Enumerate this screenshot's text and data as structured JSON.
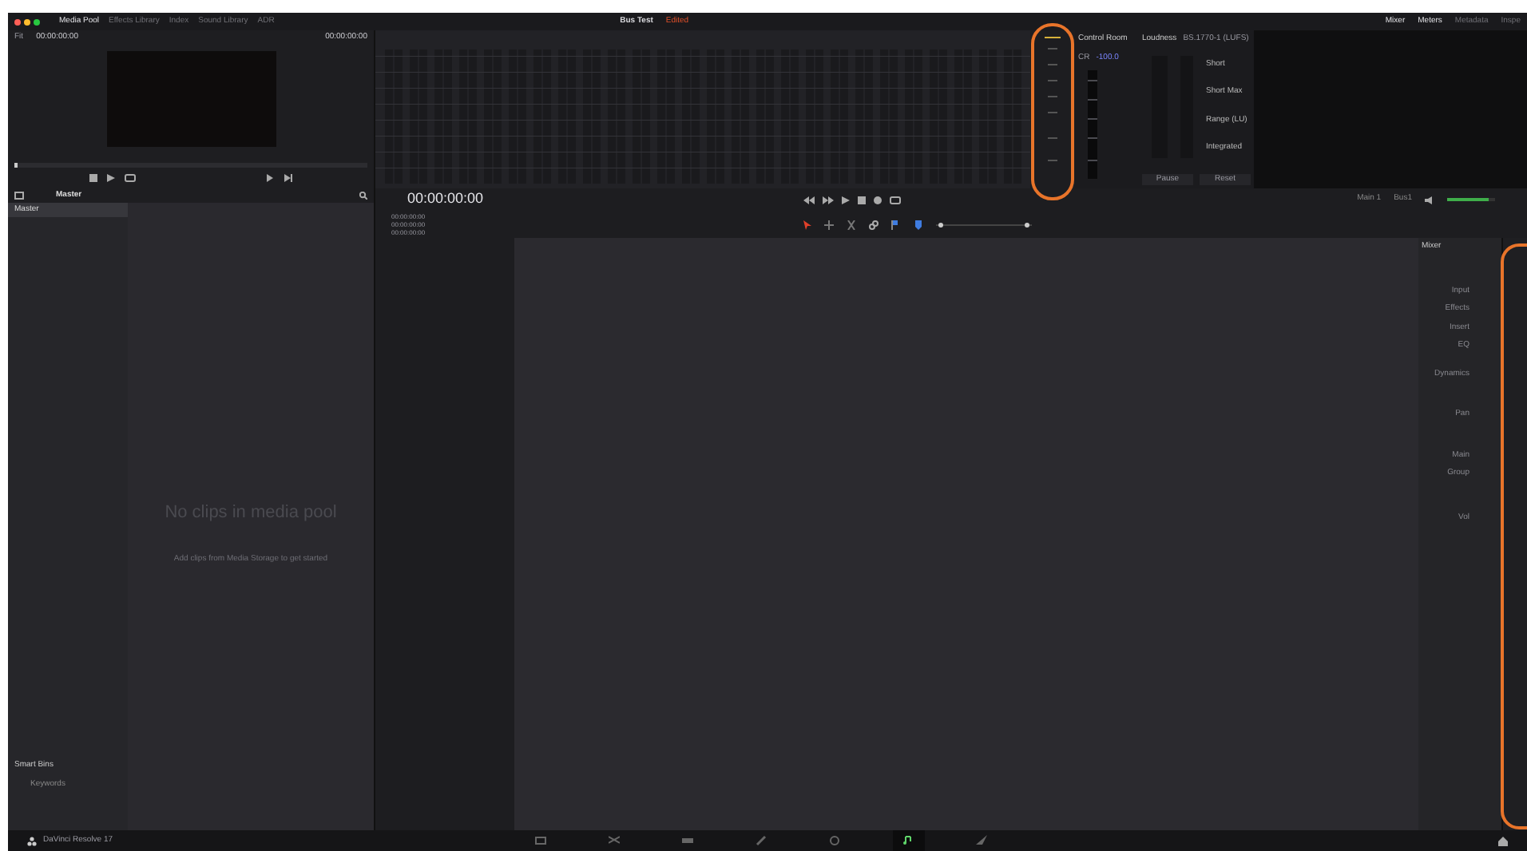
{
  "window": {
    "title": "Bus Test",
    "status": "Edited"
  },
  "toolbar_left": [
    {
      "label": "Media Pool",
      "selected": true
    },
    {
      "label": "Effects Library",
      "selected": false
    },
    {
      "label": "Index",
      "selected": false
    },
    {
      "label": "Sound Library",
      "selected": false
    },
    {
      "label": "ADR",
      "selected": false
    }
  ],
  "toolbar_right": [
    {
      "label": "Mixer",
      "selected": true
    },
    {
      "label": "Meters",
      "selected": true
    },
    {
      "label": "Metadata",
      "selected": false
    },
    {
      "label": "Inspe",
      "selected": false
    }
  ],
  "viewer": {
    "zoom": "Fit",
    "source": "00:00:00:00",
    "timecode": "00:00:00:00"
  },
  "media_pool": {
    "path": "Master",
    "bins": [
      {
        "label": "Master",
        "selected": true
      }
    ],
    "empty_title": "No clips in media pool",
    "empty_hint": "Add clips from Media Storage to get started",
    "smart_bins_heading": "Smart Bins",
    "smart_bins": [
      {
        "label": "Keywords",
        "selected": false
      }
    ]
  },
  "control_room": {
    "title": "Control Room",
    "source": "CR",
    "value": "-100.0"
  },
  "loudness": {
    "title": "Loudness",
    "standard": "BS.1770-1 (LUFS)",
    "readings": [
      "Short",
      "Short Max",
      "Range (LU)",
      "Integrated"
    ],
    "buttons": [
      "Pause",
      "Reset"
    ]
  },
  "timeline": {
    "timecode": "00:00:00:00",
    "track_times": [
      "00:00:00:00",
      "00:00:00:00",
      "00:00:00:00"
    ],
    "monitor": [
      "Main 1",
      "Bus1"
    ],
    "volume": {
      "level": 0.85
    }
  },
  "mixer": {
    "title": "Mixer",
    "rows": [
      "Input",
      "Effects",
      "Insert",
      "EQ",
      "Dynamics",
      "Pan",
      "Main",
      "Group",
      "Vol"
    ]
  },
  "status_bar": {
    "app": "DaVinci Resolve 17",
    "pages": [
      {
        "kind": "media",
        "selected": false
      },
      {
        "kind": "cut",
        "selected": false
      },
      {
        "kind": "edit",
        "selected": false
      },
      {
        "kind": "fusion",
        "selected": false
      },
      {
        "kind": "color",
        "selected": false
      },
      {
        "kind": "fairlight",
        "selected": true
      },
      {
        "kind": "deliver",
        "selected": false
      }
    ]
  }
}
